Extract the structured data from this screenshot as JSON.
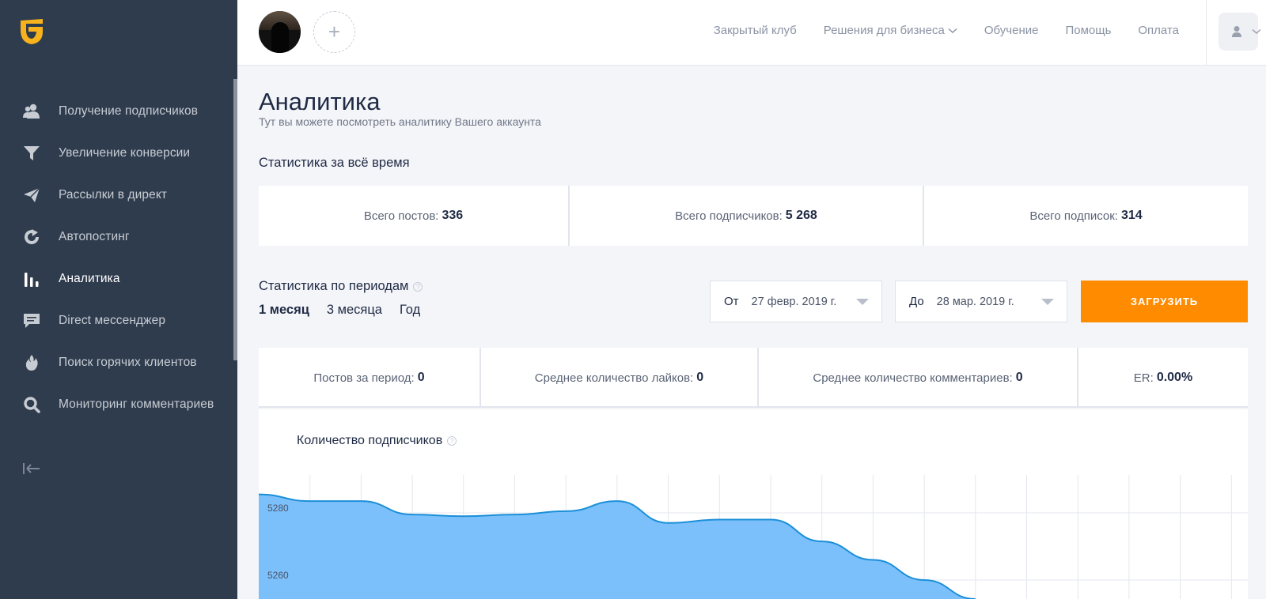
{
  "sidebar": {
    "items": [
      {
        "label": "Получение подписчиков",
        "icon": "users-icon"
      },
      {
        "label": "Увеличение конверсии",
        "icon": "funnel-icon"
      },
      {
        "label": "Рассылки в директ",
        "icon": "paper-plane-icon"
      },
      {
        "label": "Автопостинг",
        "icon": "refresh-icon"
      },
      {
        "label": "Аналитика",
        "icon": "bar-chart-icon",
        "active": true
      },
      {
        "label": "Direct мессенджер",
        "icon": "message-icon"
      },
      {
        "label": "Поиск горячих клиентов",
        "icon": "flame-icon"
      },
      {
        "label": "Мониторинг комментариев",
        "icon": "search-icon"
      }
    ]
  },
  "topnav": {
    "items": [
      "Закрытый клуб",
      "Решения для бизнеса",
      "Обучение",
      "Помощь",
      "Оплата"
    ],
    "add_account": "+"
  },
  "page": {
    "title": "Аналитика",
    "subtitle": "Тут вы можете посмотреть аналитику Вашего аккаунта"
  },
  "all_time": {
    "title": "Статистика за всё время",
    "posts_label": "Всего постов:",
    "posts_value": "336",
    "followers_label": "Всего подписчиков:",
    "followers_value": "5 268",
    "following_label": "Всего подписок:",
    "following_value": "314"
  },
  "period": {
    "title": "Статистика по периодам",
    "tabs": [
      "1 месяц",
      "3 месяца",
      "Год"
    ],
    "from_label": "От",
    "from_value": "27 февр. 2019 г.",
    "to_label": "До",
    "to_value": "28 мар. 2019 г.",
    "load_button": "ЗАГРУЗИТЬ",
    "posts_label": "Постов за период:",
    "posts_value": "0",
    "likes_label": "Среднее количество лайков:",
    "likes_value": "0",
    "comments_label": "Среднее количество комментариев:",
    "comments_value": "0",
    "er_label": "ER:",
    "er_value": "0.00%"
  },
  "colors": {
    "sidebar": "#2f3c4e",
    "accent": "#ff8c00",
    "chart_fill": "#7cc0fb",
    "chart_line": "#1b8fd8"
  },
  "chart_data": {
    "type": "area",
    "title": "Количество подписчиков",
    "yticks": [
      5280,
      5260
    ],
    "ylim": [
      5254.35,
      5291.3
    ],
    "x": [
      0,
      1,
      2,
      3,
      4,
      5,
      6,
      7,
      8,
      9,
      10,
      11,
      12,
      13,
      14
    ],
    "values": [
      5285.5,
      5283.5,
      5283.5,
      5279.5,
      5279,
      5279.5,
      5280.5,
      5283.5,
      5277,
      5278,
      5278,
      5271.5,
      5266,
      5260,
      5254.35
    ],
    "grid": true
  }
}
